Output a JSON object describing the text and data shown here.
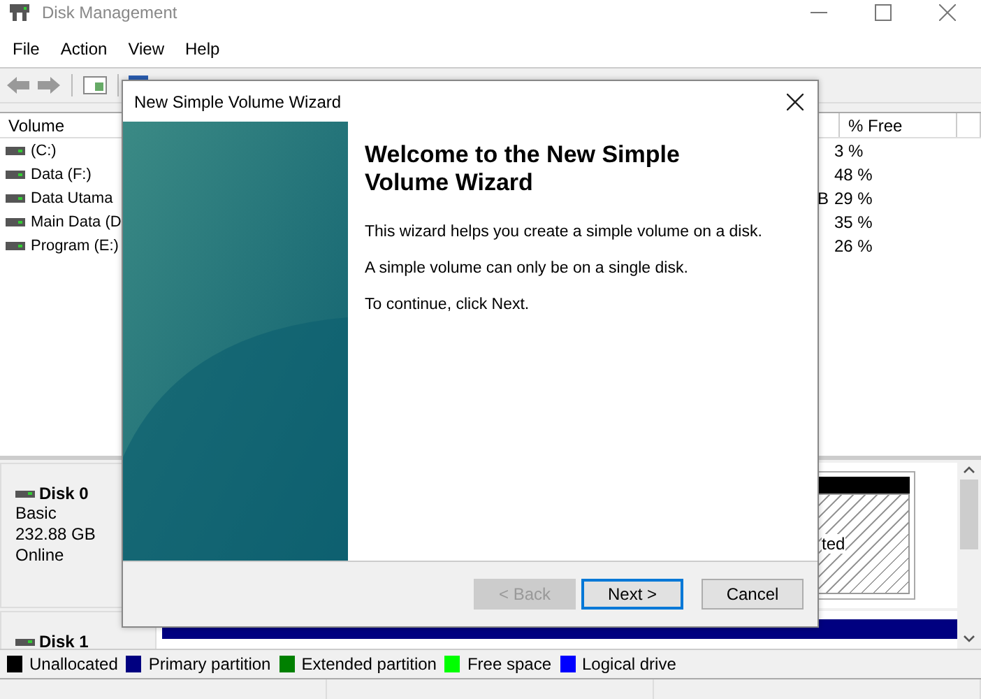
{
  "window": {
    "title": "Disk Management"
  },
  "menu": [
    "File",
    "Action",
    "View",
    "Help"
  ],
  "volume_list": {
    "columns": [
      "Volume",
      "% Free"
    ],
    "rows": [
      {
        "volume": "(C:)",
        "free": "3 %"
      },
      {
        "volume": "Data (F:)",
        "free": "48 %"
      },
      {
        "volume": "Data Utama",
        "cut_cell": "B",
        "free": "29 %"
      },
      {
        "volume": "Main Data (D",
        "free": "35 %"
      },
      {
        "volume": "Program (E:)",
        "free": "26 %"
      }
    ]
  },
  "disks": [
    {
      "name": "Disk 0",
      "lines": [
        "Basic",
        "232.88 GB",
        "Online"
      ],
      "partition_label": "ted"
    },
    {
      "name": "Disk 1"
    }
  ],
  "legend": [
    {
      "label": "Unallocated",
      "color": "#000000"
    },
    {
      "label": "Primary partition",
      "color": "#000080"
    },
    {
      "label": "Extended partition",
      "color": "#008000"
    },
    {
      "label": "Free space",
      "color": "#00ff00"
    },
    {
      "label": "Logical drive",
      "color": "#0000ff"
    }
  ],
  "dialog": {
    "title": "New Simple Volume Wizard",
    "heading": "Welcome to the New Simple Volume Wizard",
    "paragraphs": [
      "This wizard helps you create a simple volume on a disk.",
      "A simple volume can only be on a single disk.",
      "To continue, click Next."
    ],
    "buttons": [
      {
        "label": "< Back",
        "disabled": true,
        "default": false
      },
      {
        "label": "Next >",
        "disabled": false,
        "default": true
      },
      {
        "label": "Cancel",
        "disabled": false,
        "default": false
      }
    ]
  }
}
